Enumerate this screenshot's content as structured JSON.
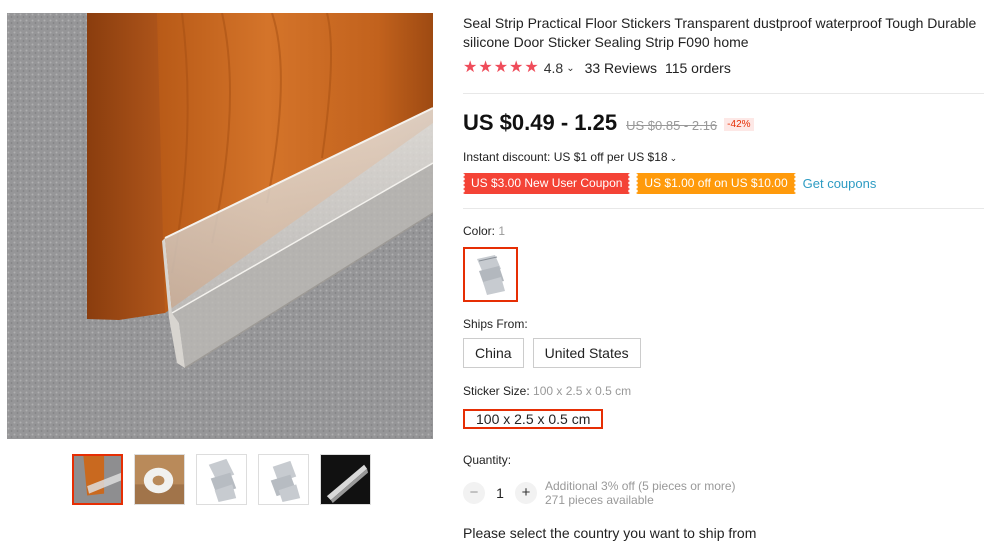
{
  "product": {
    "title": "Seal Strip Practical Floor Stickers Transparent dustproof waterproof Tough Durable silicone Door Sticker Sealing Strip F090 home",
    "rating": "4.8",
    "reviews": "33 Reviews",
    "orders": "115 orders"
  },
  "gallery": {
    "main_image": "door-seal-strip-photo",
    "thumbnails": [
      "door-seal-thumb",
      "seal-roll-thumb",
      "seal-strip-pack-thumb",
      "seal-strip-pack-thumb-2",
      "seal-strip-black-thumb"
    ],
    "active_index": 0
  },
  "price": {
    "current": "US $0.49 - 1.25",
    "original": "US $0.85 - 2.16",
    "discount": "-42%"
  },
  "promo": {
    "instant_discount": "Instant discount: US $1 off per US $18",
    "coupon_new_user": "US $3.00 New User Coupon",
    "coupon_off": "US $1.00 off on US $10.00",
    "get_coupons": "Get coupons"
  },
  "options": {
    "color_label": "Color:",
    "color_value": "1",
    "ships_from_label": "Ships From:",
    "ships_from": [
      "China",
      "United States"
    ],
    "size_label": "Sticker Size:",
    "size_value": "100 x 2.5 x 0.5 cm",
    "size_option": "100 x 2.5 x 0.5 cm"
  },
  "quantity": {
    "label": "Quantity:",
    "value": "1",
    "minus": "−",
    "plus": "+",
    "bulk_note": "Additional 3% off (5 pieces or more)",
    "available": "271 pieces available"
  },
  "ship_note": "Please select the country you want to ship from",
  "colors": {
    "accent": "#e62e04",
    "star": "#ef4c5a",
    "coupon_red": "#f44336",
    "coupon_orange": "#ff9a0b",
    "link": "#2e9cc3"
  }
}
